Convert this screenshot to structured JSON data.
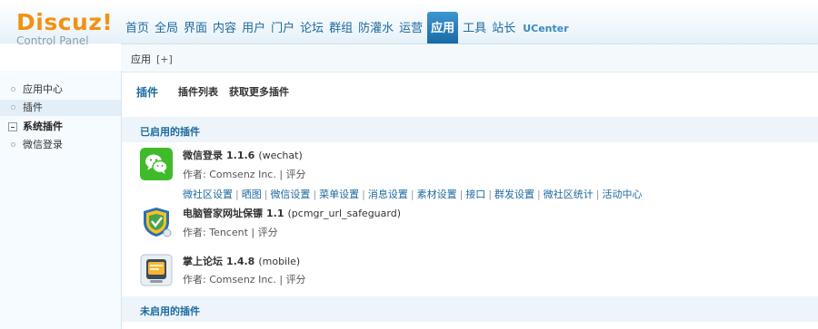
{
  "brand": {
    "name": "Discuz!",
    "sub": "Control Panel"
  },
  "topnav": [
    {
      "label": "首页",
      "active": false
    },
    {
      "label": "全局",
      "active": false
    },
    {
      "label": "界面",
      "active": false
    },
    {
      "label": "内容",
      "active": false
    },
    {
      "label": "用户",
      "active": false
    },
    {
      "label": "门户",
      "active": false
    },
    {
      "label": "论坛",
      "active": false
    },
    {
      "label": "群组",
      "active": false
    },
    {
      "label": "防灌水",
      "active": false
    },
    {
      "label": "运营",
      "active": false
    },
    {
      "label": "应用",
      "active": true
    },
    {
      "label": "工具",
      "active": false
    },
    {
      "label": "站长",
      "active": false
    },
    {
      "label": "UCenter",
      "active": false
    }
  ],
  "subbar": {
    "label": "应用",
    "plus": "[+]"
  },
  "sidebar": {
    "items": [
      {
        "label": "应用中心"
      },
      {
        "label": "插件"
      },
      {
        "label": "系统插件"
      },
      {
        "label": "微信登录"
      }
    ]
  },
  "tabs": [
    {
      "label": "插件"
    },
    {
      "label": "插件列表"
    },
    {
      "label": "获取更多插件"
    }
  ],
  "sections": {
    "enabled": "已启用的插件",
    "disabled": "未启用的插件"
  },
  "plugins": [
    {
      "name": "微信登录",
      "version": "1.1.6",
      "id": "(wechat)",
      "author_label": "作者: Comsenz Inc.",
      "sep": "|",
      "rate": "评分",
      "links": [
        "微社区设置",
        "晒图",
        "微信设置",
        "菜单设置",
        "消息设置",
        "素材设置",
        "接口",
        "群发设置",
        "微社区统计",
        "活动中心"
      ],
      "icon": "wechat-icon"
    },
    {
      "name": "电脑管家网址保镖",
      "version": "1.1",
      "id": "(pcmgr_url_safeguard)",
      "author_label": "作者: Tencent",
      "sep": "|",
      "rate": "评分",
      "icon": "shield-icon"
    },
    {
      "name": "掌上论坛",
      "version": "1.4.8",
      "id": "(mobile)",
      "author_label": "作者: Comsenz Inc.",
      "sep": "|",
      "rate": "评分",
      "icon": "mobile-forum-icon"
    }
  ],
  "colors": {
    "accent": "#1e6aa0",
    "logo": "#f29213",
    "wechat": "#3fbb2a",
    "active_tab": "#2a82bf"
  }
}
